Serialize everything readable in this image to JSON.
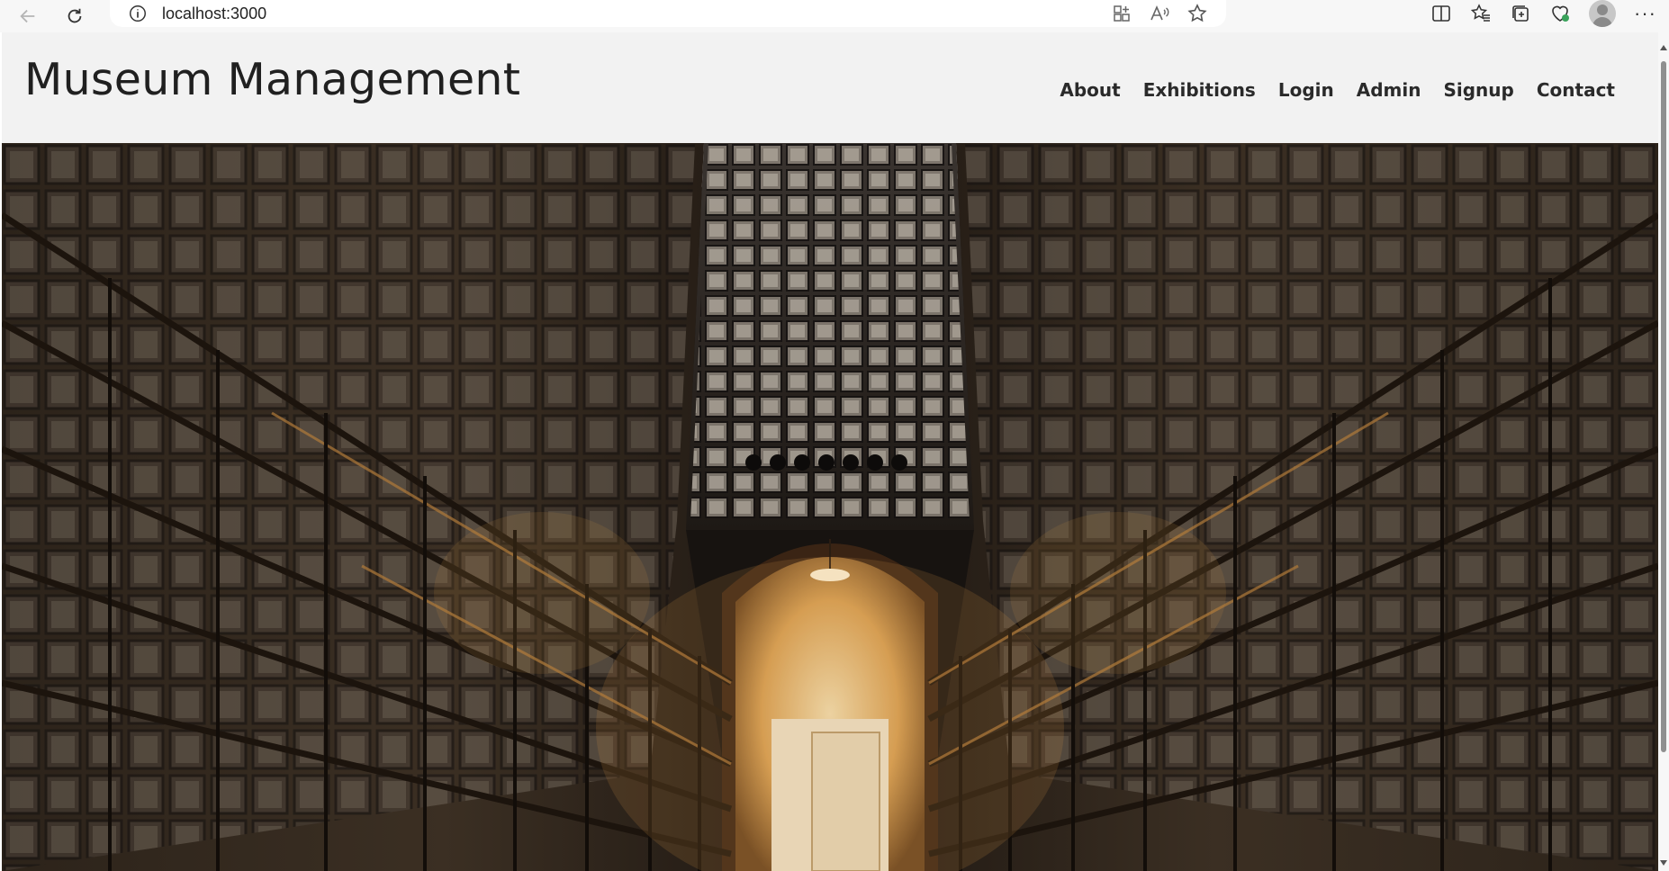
{
  "browser": {
    "url": "localhost:3000"
  },
  "site": {
    "title": "Museum Management",
    "nav": [
      {
        "label": "About"
      },
      {
        "label": "Exhibitions"
      },
      {
        "label": "Login"
      },
      {
        "label": "Admin"
      },
      {
        "label": "Signup"
      },
      {
        "label": "Contact"
      }
    ]
  },
  "hero": {
    "image": "museum-hall-of-photographs",
    "colors": {
      "shadow": "#171310",
      "wood": "#3a2a1c",
      "glow": "#d9a256",
      "light": "#f4e2b6"
    }
  },
  "icons": {
    "back": "back-arrow-icon",
    "refresh": "refresh-icon",
    "info": "info-icon",
    "app": "app-icon",
    "read_aloud": "read-aloud-icon",
    "favorite": "star-icon",
    "split": "split-screen-icon",
    "favorites": "favorites-icon",
    "collections": "collections-icon",
    "health": "browser-essentials-icon",
    "profile": "profile-avatar",
    "more": "more-icon"
  }
}
